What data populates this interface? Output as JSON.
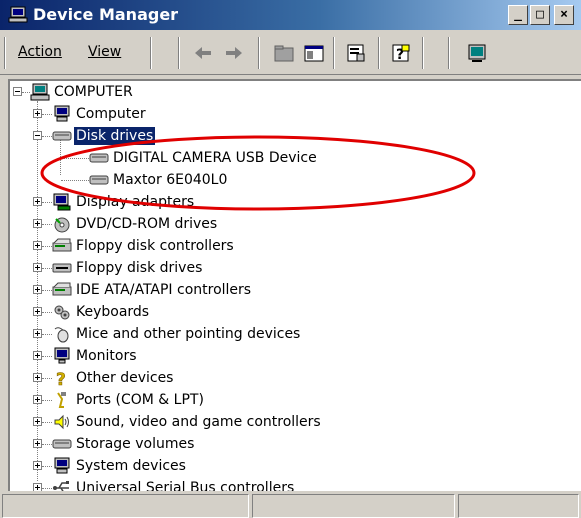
{
  "window": {
    "title": "Device Manager",
    "minimize": "_",
    "maximize": "□",
    "close": "×"
  },
  "menu": {
    "action": "Action",
    "view": "View"
  },
  "tree": {
    "root": "COMPUTER",
    "items": [
      {
        "label": "Computer",
        "icon": "computer-icon"
      },
      {
        "label": "Disk drives",
        "icon": "disk-drive-icon",
        "expanded": true,
        "children": [
          {
            "label": "DIGITAL CAMERA USB Device",
            "icon": "disk-drive-icon"
          },
          {
            "label": "Maxtor 6E040L0",
            "icon": "disk-drive-icon"
          }
        ]
      },
      {
        "label": "Display adapters",
        "icon": "display-adapter-icon"
      },
      {
        "label": "DVD/CD-ROM drives",
        "icon": "cdrom-icon"
      },
      {
        "label": "Floppy disk controllers",
        "icon": "controller-icon"
      },
      {
        "label": "Floppy disk drives",
        "icon": "floppy-drive-icon"
      },
      {
        "label": "IDE ATA/ATAPI controllers",
        "icon": "controller-icon"
      },
      {
        "label": "Keyboards",
        "icon": "keyboard-icon"
      },
      {
        "label": "Mice and other pointing devices",
        "icon": "mouse-icon"
      },
      {
        "label": "Monitors",
        "icon": "monitor-icon"
      },
      {
        "label": "Other devices",
        "icon": "question-icon"
      },
      {
        "label": "Ports (COM & LPT)",
        "icon": "port-icon"
      },
      {
        "label": "Sound, video and game controllers",
        "icon": "sound-icon"
      },
      {
        "label": "Storage volumes",
        "icon": "disk-drive-icon"
      },
      {
        "label": "System devices",
        "icon": "computer-icon"
      },
      {
        "label": "Universal Serial Bus controllers",
        "icon": "usb-icon"
      }
    ]
  },
  "colors": {
    "title_start": "#0a246a",
    "title_end": "#a6caf0",
    "selection": "#0a246a",
    "annotation": "#e00000"
  }
}
